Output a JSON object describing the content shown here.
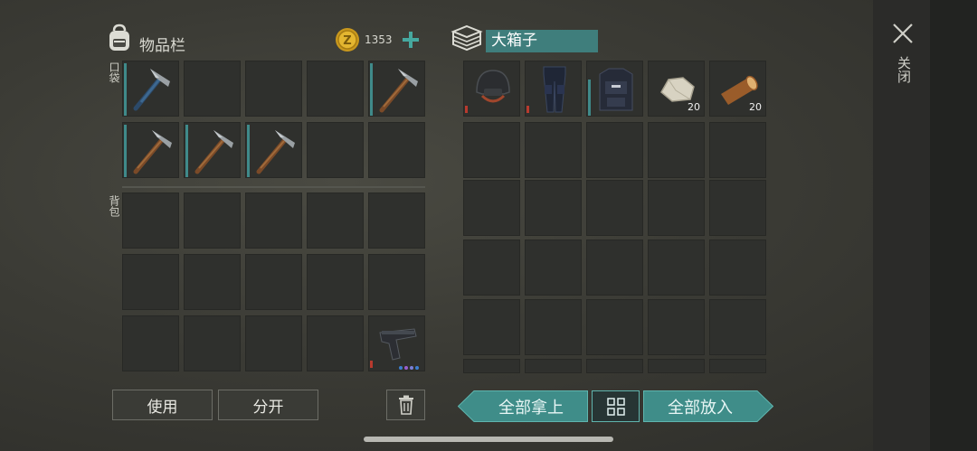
{
  "inventory": {
    "title": "物品栏",
    "currency_amount": "1353",
    "pocket_label": "口袋",
    "backpack_label": "背包",
    "pocket_items": [
      {
        "slot": 0,
        "item": "pickaxe-icon"
      },
      {
        "slot": 4,
        "item": "pickaxe-icon"
      },
      {
        "slot": 5,
        "item": "pickaxe-icon"
      },
      {
        "slot": 6,
        "item": "pickaxe-icon"
      },
      {
        "slot": 7,
        "item": "pickaxe-icon"
      }
    ],
    "backpack_items": [
      {
        "slot": 14,
        "item": "pistol-icon"
      }
    ]
  },
  "container": {
    "title": "大箱子",
    "items": [
      {
        "slot": 0,
        "item": "helmet-icon"
      },
      {
        "slot": 1,
        "item": "armored-pants-icon"
      },
      {
        "slot": 2,
        "item": "armored-vest-icon"
      },
      {
        "slot": 3,
        "item": "stone-icon",
        "qty": "20"
      },
      {
        "slot": 4,
        "item": "wood-log-icon",
        "qty": "20"
      }
    ]
  },
  "buttons": {
    "use": "使用",
    "split": "分开",
    "take_all": "全部拿上",
    "put_all": "全部放入"
  },
  "close_label": "关闭",
  "colors": {
    "accent": "#3f8d89",
    "durability_red": "#b83a2e",
    "background": "#3b3b35"
  }
}
